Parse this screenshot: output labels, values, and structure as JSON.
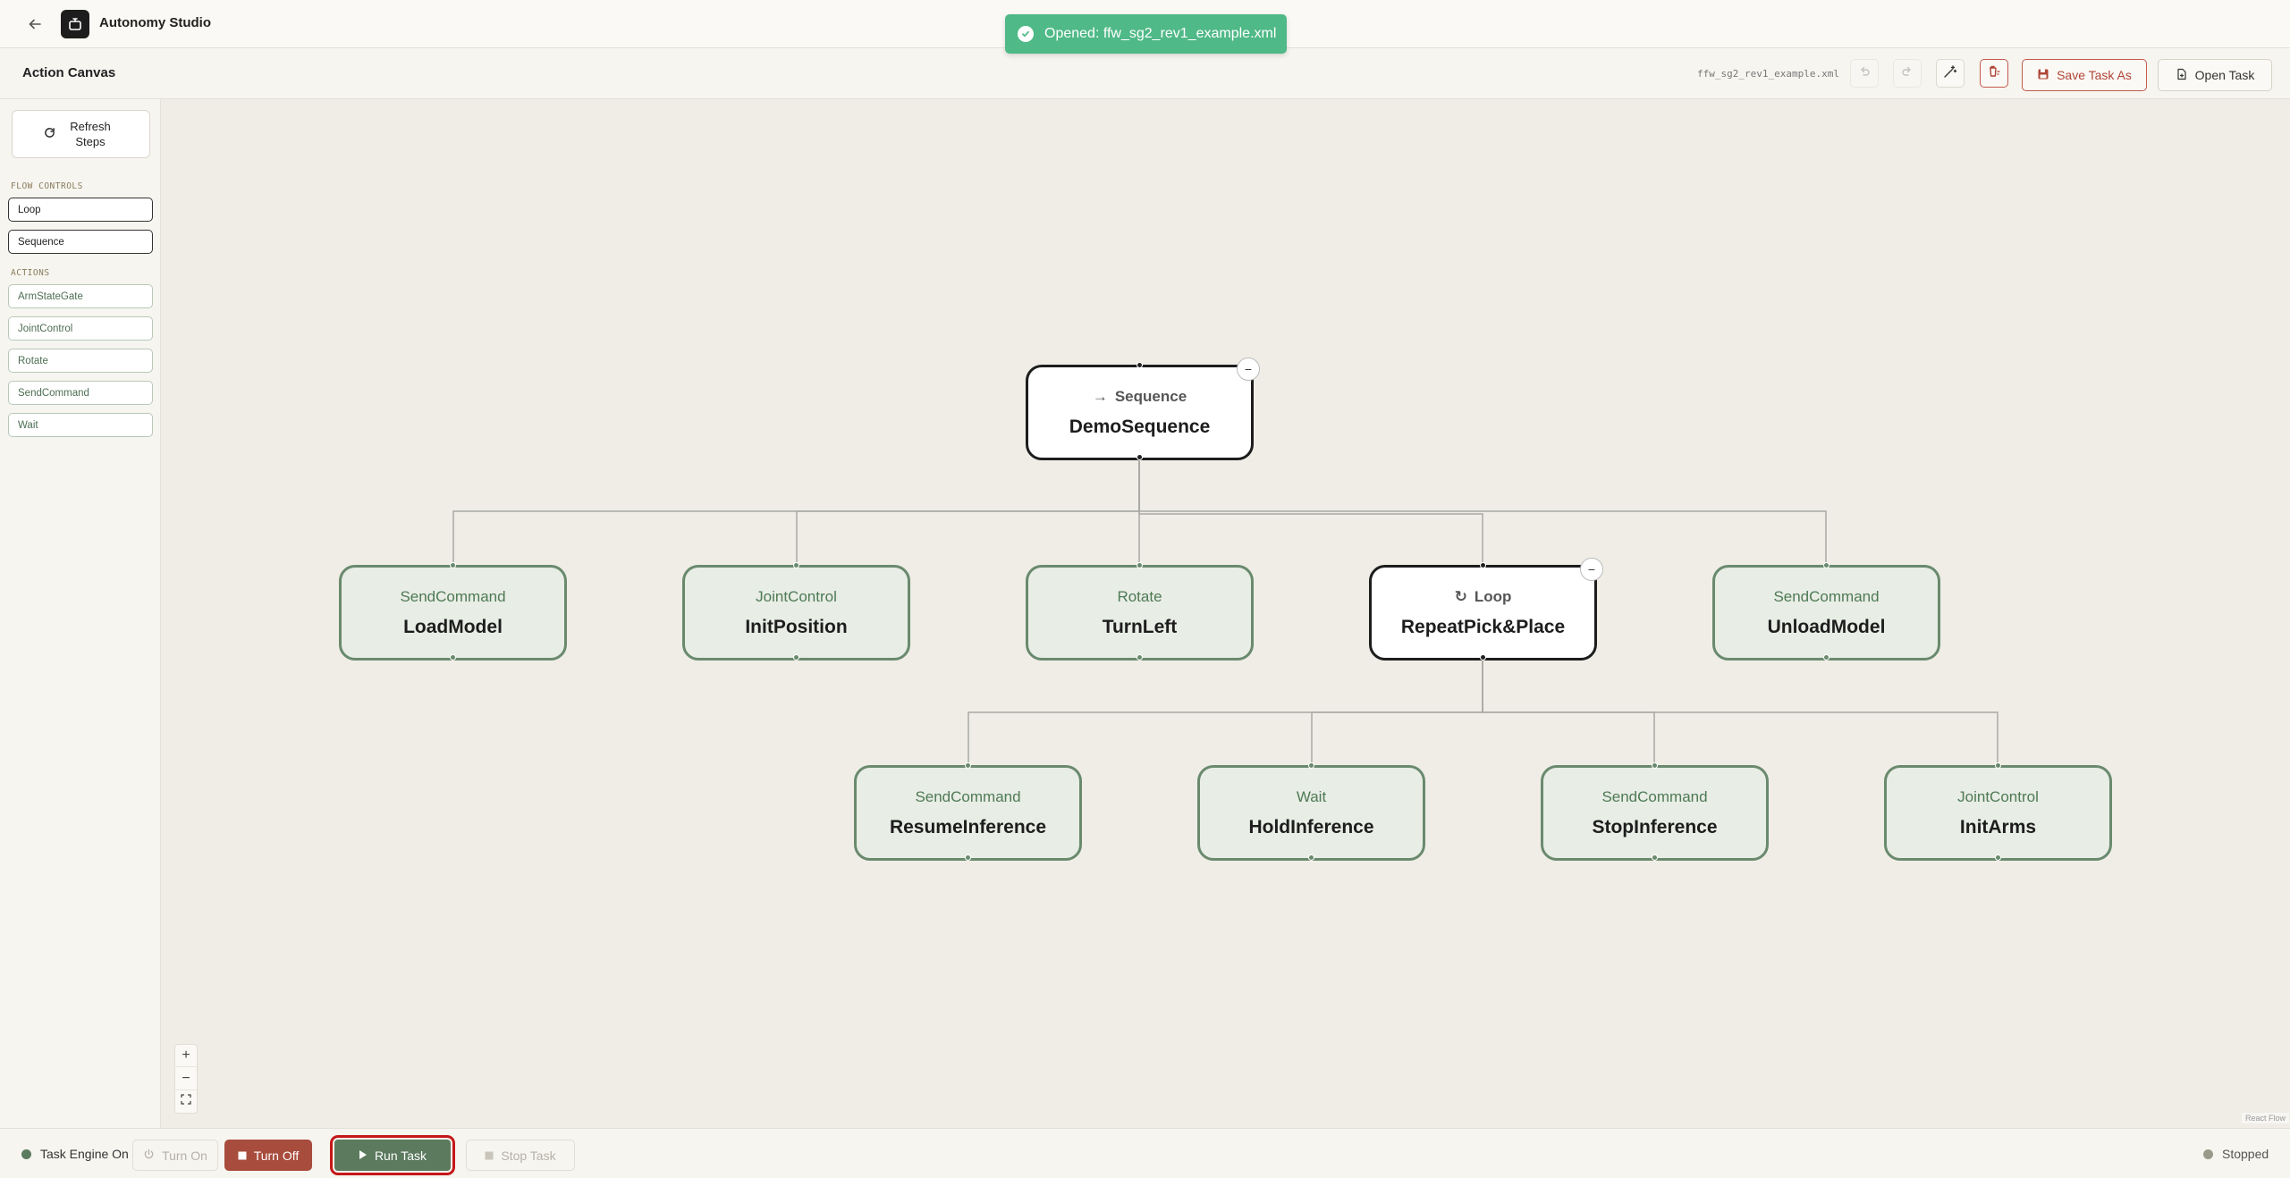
{
  "app": {
    "title": "Autonomy Studio"
  },
  "toast": {
    "message": "Opened: ffw_sg2_rev1_example.xml"
  },
  "subheader": {
    "title": "Action Canvas",
    "file_name": "ffw_sg2_rev1_example.xml",
    "save_label": "Save Task As",
    "open_label": "Open Task"
  },
  "sidebar": {
    "refresh_label": "Refresh Steps",
    "flow_controls_label": "FLOW CONTROLS",
    "flow_controls": [
      "Loop",
      "Sequence"
    ],
    "actions_label": "ACTIONS",
    "actions": [
      "ArmStateGate",
      "JointControl",
      "Rotate",
      "SendCommand",
      "Wait"
    ]
  },
  "tree": {
    "root": {
      "type": "Sequence",
      "name": "DemoSequence"
    },
    "level1": [
      {
        "type": "SendCommand",
        "name": "LoadModel"
      },
      {
        "type": "JointControl",
        "name": "InitPosition"
      },
      {
        "type": "Rotate",
        "name": "TurnLeft"
      },
      {
        "type": "Loop",
        "name": "RepeatPick&Place"
      },
      {
        "type": "SendCommand",
        "name": "UnloadModel"
      }
    ],
    "level2": [
      {
        "type": "SendCommand",
        "name": "ResumeInference"
      },
      {
        "type": "Wait",
        "name": "HoldInference"
      },
      {
        "type": "SendCommand",
        "name": "StopInference"
      },
      {
        "type": "JointControl",
        "name": "InitArms"
      }
    ]
  },
  "canvas": {
    "attribution": "React Flow"
  },
  "bottombar": {
    "engine_status": "Task Engine On",
    "turn_on_label": "Turn On",
    "turn_off_label": "Turn Off",
    "run_task_label": "Run Task",
    "stop_task_label": "Stop Task",
    "run_status": "Stopped"
  },
  "colors": {
    "action_node_border": "#6a8a6e",
    "action_node_fill": "#e8ede5",
    "flow_node_border": "#1d1d1d",
    "toast": "#4fb987",
    "danger": "#a84c3d",
    "run": "#5b7a5e",
    "status_green": "#5b7a5e",
    "status_stopped": "#9a9a8a"
  }
}
